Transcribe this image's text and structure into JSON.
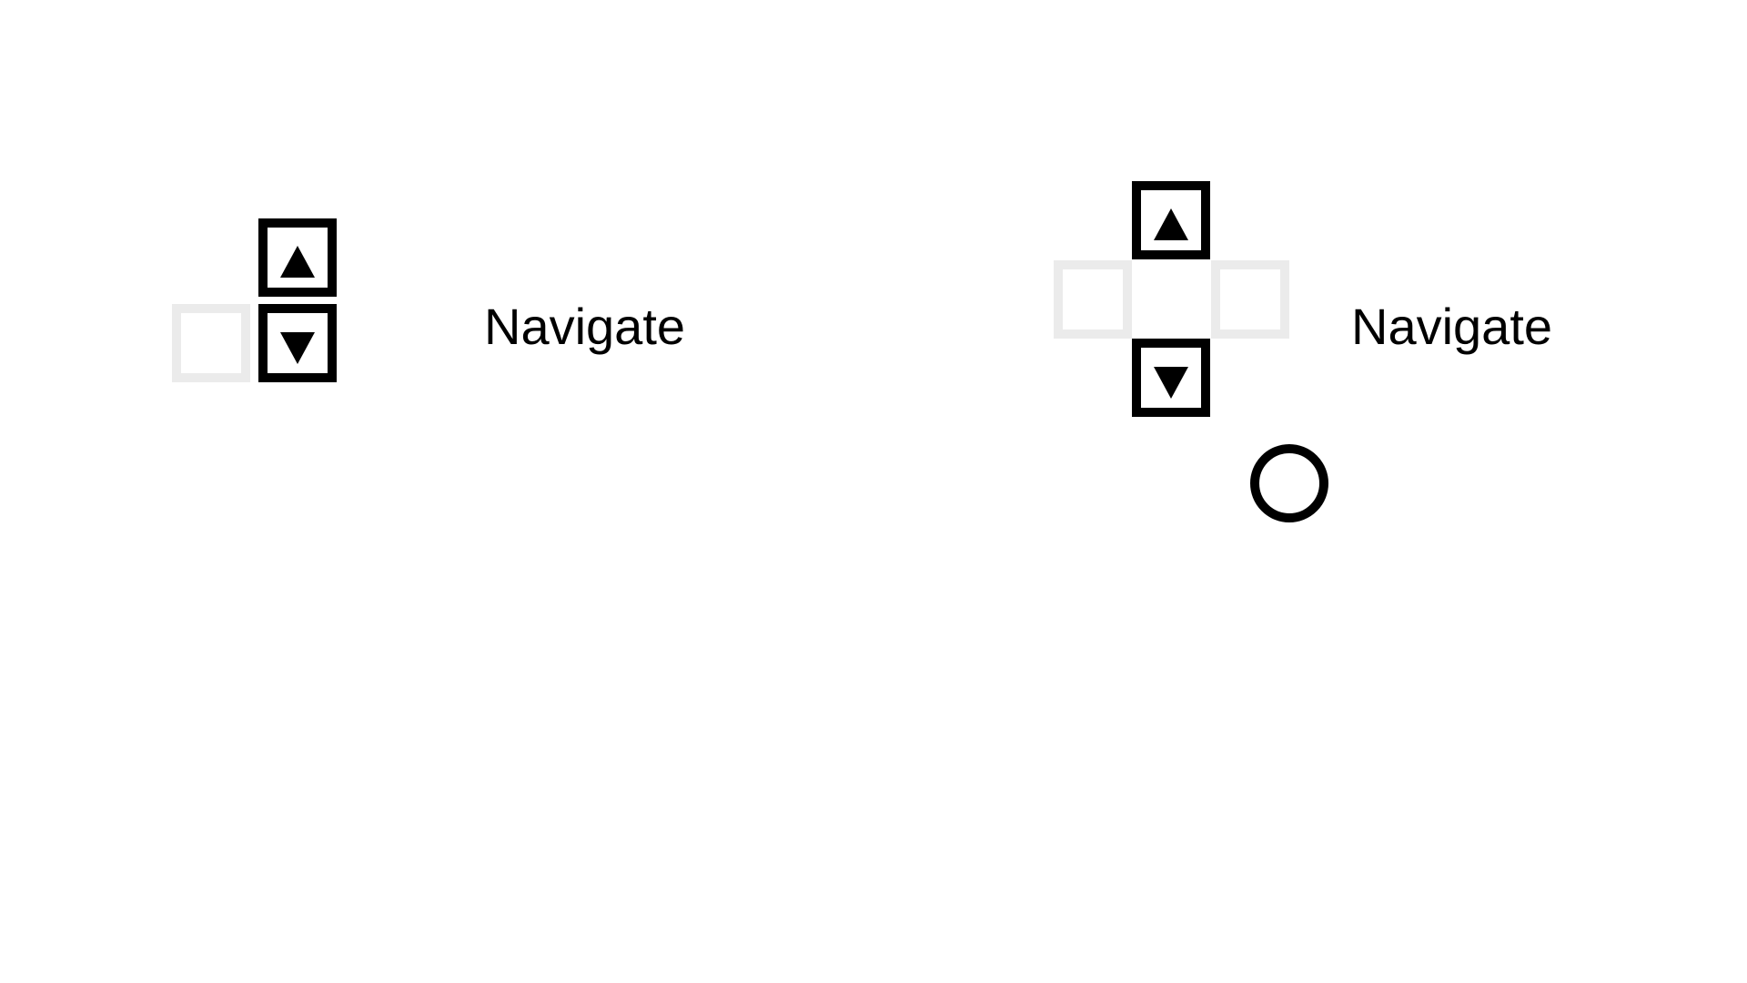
{
  "colors": {
    "active_key": "#000000",
    "inactive_key": "#ebebeb",
    "background": "#ffffff",
    "text": "#000000"
  },
  "groups": [
    {
      "label": "Navigate",
      "keys": [
        {
          "icon": "up-arrow-icon",
          "active": true
        },
        {
          "icon": "blank-key",
          "active": false
        },
        {
          "icon": "down-arrow-icon",
          "active": true
        }
      ]
    },
    {
      "label": "Navigate",
      "keys": [
        {
          "icon": "up-arrow-icon",
          "active": true
        },
        {
          "icon": "blank-key",
          "active": false
        },
        {
          "icon": "blank-key",
          "active": false
        },
        {
          "icon": "down-arrow-icon",
          "active": true
        }
      ],
      "extra_icon": "circle-button-icon"
    }
  ]
}
